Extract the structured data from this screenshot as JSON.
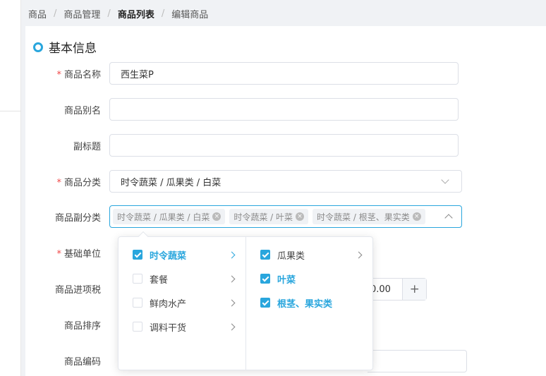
{
  "breadcrumb": [
    "商品",
    "商品管理",
    "商品列表",
    "编辑商品"
  ],
  "section": {
    "title": "基本信息"
  },
  "form": {
    "name": {
      "label": "商品名称",
      "value": "西生菜P",
      "required": true
    },
    "alias": {
      "label": "商品别名",
      "value": ""
    },
    "subtitle": {
      "label": "副标题",
      "value": ""
    },
    "category": {
      "label": "商品分类",
      "value": "时令蔬菜 / 瓜果类 / 白菜",
      "required": true
    },
    "sub_category": {
      "label": "商品副分类",
      "tags": [
        "时令蔬菜 / 瓜果类 / 白菜",
        "时令蔬菜 / 叶菜",
        "时令蔬菜 / 根茎、果实类"
      ]
    },
    "unit": {
      "label": "基础单位",
      "required": true
    },
    "tax": {
      "label": "商品进项税",
      "value_fragment": "0.00",
      "plus": "+"
    },
    "sort": {
      "label": "商品排序"
    },
    "code": {
      "label": "商品编码"
    }
  },
  "cascader": {
    "level1": [
      {
        "label": "时令蔬菜",
        "checked": true,
        "active": true
      },
      {
        "label": "套餐",
        "checked": false
      },
      {
        "label": "鲜肉水产",
        "checked": false
      },
      {
        "label": "调料干货",
        "checked": false
      }
    ],
    "level2": [
      {
        "label": "瓜果类",
        "checked": true,
        "active": false,
        "has_children": true
      },
      {
        "label": "叶菜",
        "checked": true,
        "active": true,
        "has_children": false
      },
      {
        "label": "根茎、果实类",
        "checked": true,
        "active": true,
        "has_children": false
      }
    ]
  },
  "colors": {
    "accent": "#29a6dd",
    "required": "#f04848"
  }
}
